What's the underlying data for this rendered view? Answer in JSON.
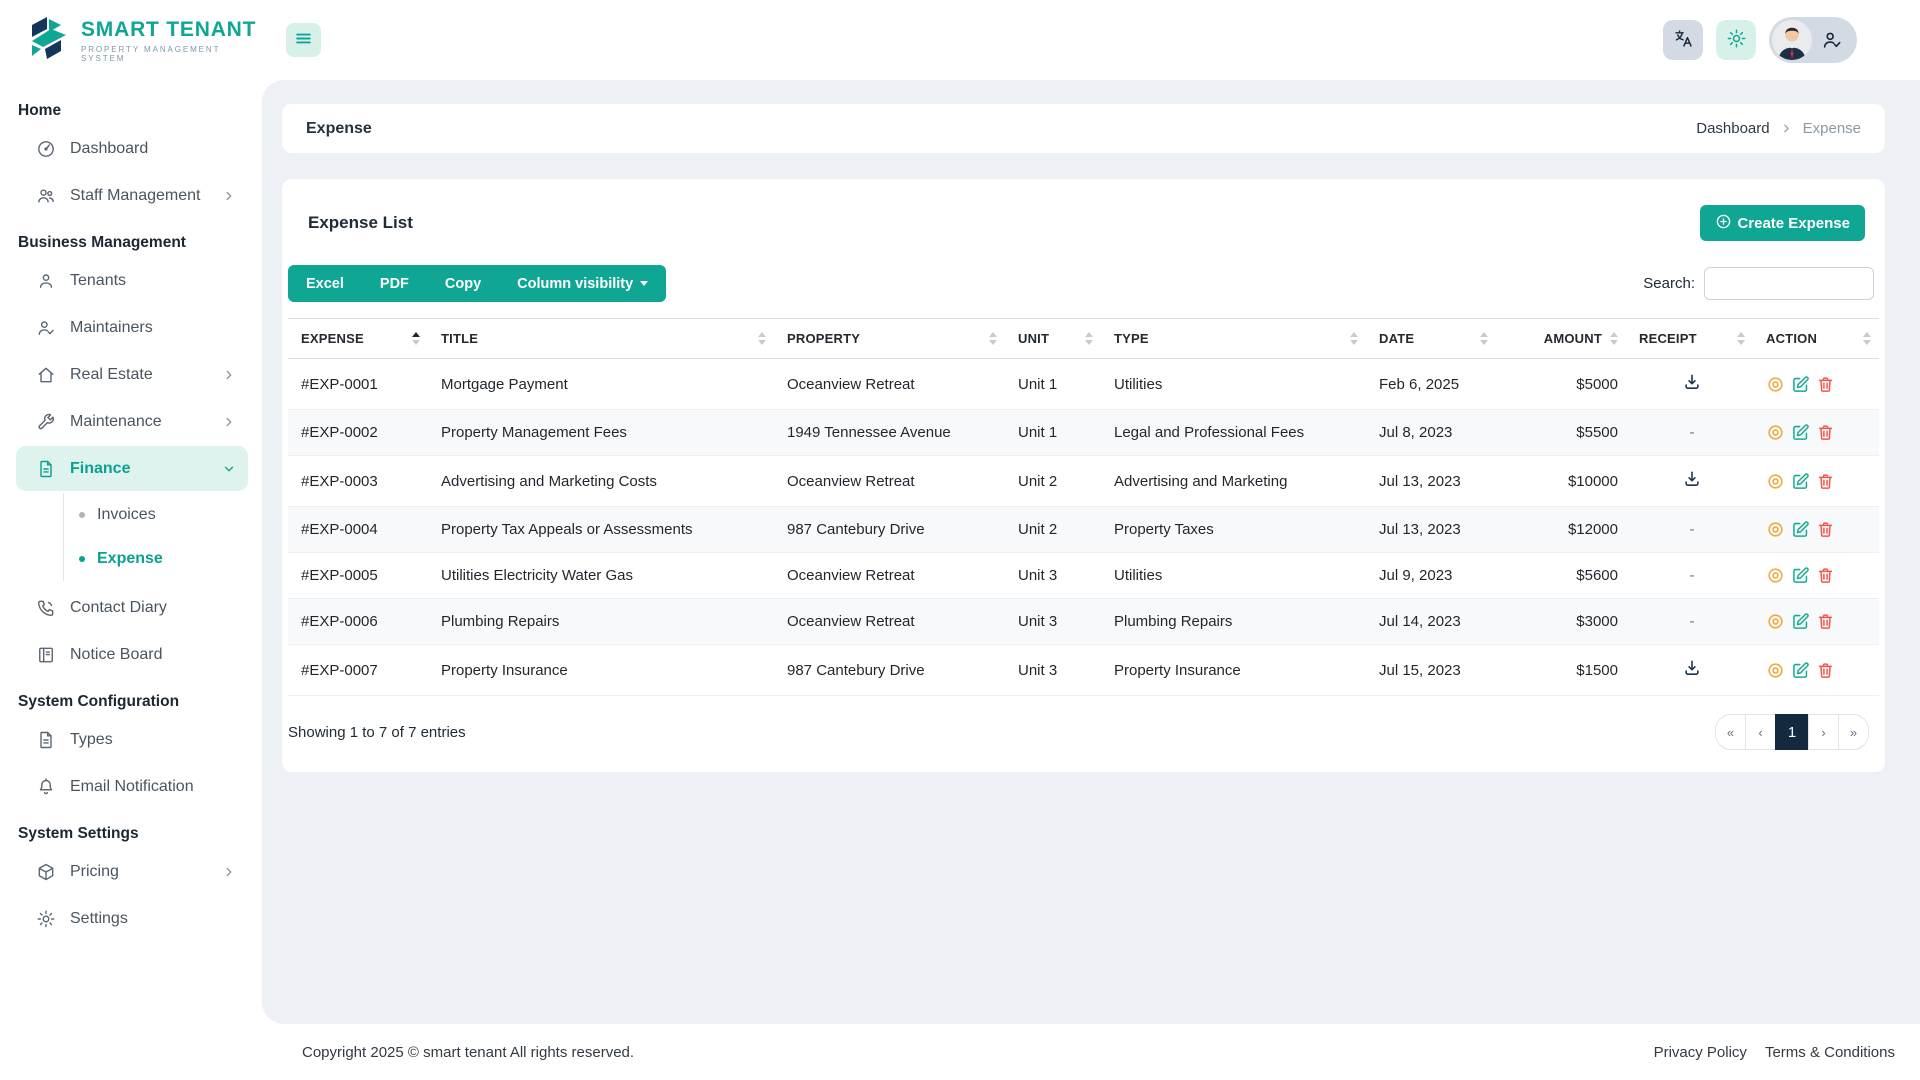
{
  "brand": {
    "name": "SMART TENANT",
    "tagline": "PROPERTY MANAGEMENT SYSTEM"
  },
  "topbar": {
    "icons": [
      "menu-icon",
      "translate-icon",
      "gear-icon",
      "user-avatar",
      "person-check-icon"
    ]
  },
  "sidebar": {
    "sections": [
      {
        "label": "Home",
        "items": [
          {
            "label": "Dashboard",
            "icon": "dashboard-icon"
          },
          {
            "label": "Staff Management",
            "icon": "staff-icon",
            "expandable": true
          }
        ]
      },
      {
        "label": "Business Management",
        "items": [
          {
            "label": "Tenants",
            "icon": "tenant-icon"
          },
          {
            "label": "Maintainers",
            "icon": "maintainer-icon"
          },
          {
            "label": "Real Estate",
            "icon": "home-icon",
            "expandable": true
          },
          {
            "label": "Maintenance",
            "icon": "wrench-icon",
            "expandable": true
          },
          {
            "label": "Finance",
            "icon": "finance-icon",
            "active": true,
            "expanded": true,
            "children": [
              {
                "label": "Invoices"
              },
              {
                "label": "Expense",
                "active": true
              }
            ]
          },
          {
            "label": "Contact Diary",
            "icon": "contact-icon"
          },
          {
            "label": "Notice Board",
            "icon": "board-icon"
          }
        ]
      },
      {
        "label": "System Configuration",
        "items": [
          {
            "label": "Types",
            "icon": "types-icon"
          },
          {
            "label": "Email Notification",
            "icon": "bell-icon"
          }
        ]
      },
      {
        "label": "System Settings",
        "items": [
          {
            "label": "Pricing",
            "icon": "pricing-icon",
            "expandable": true
          },
          {
            "label": "Settings",
            "icon": "settings-icon"
          }
        ]
      }
    ]
  },
  "page": {
    "breadcrumb_title": "Expense",
    "breadcrumb": [
      "Dashboard",
      "Expense"
    ]
  },
  "expense_card": {
    "title": "Expense List",
    "create_button": "Create Expense",
    "export_buttons": [
      "Excel",
      "PDF",
      "Copy"
    ],
    "column_visibility_label": "Column visibility",
    "search_label": "Search:",
    "table": {
      "columns": [
        "EXPENSE",
        "TITLE",
        "PROPERTY",
        "UNIT",
        "TYPE",
        "DATE",
        "AMOUNT",
        "RECEIPT",
        "ACTION"
      ],
      "sorted_column_index": 0,
      "sort_direction": "asc",
      "action_icons": [
        "view-icon",
        "edit-icon",
        "delete-icon"
      ],
      "receipt_icon": "download-icon",
      "rows": [
        {
          "expense": "#EXP-0001",
          "title": "Mortgage Payment",
          "property": "Oceanview Retreat",
          "unit": "Unit 1",
          "type": "Utilities",
          "date": "Feb 6, 2025",
          "amount": "$5000",
          "receipt": "download"
        },
        {
          "expense": "#EXP-0002",
          "title": "Property Management Fees",
          "property": "1949 Tennessee Avenue",
          "unit": "Unit 1",
          "type": "Legal and Professional Fees",
          "date": "Jul 8, 2023",
          "amount": "$5500",
          "receipt": "-"
        },
        {
          "expense": "#EXP-0003",
          "title": "Advertising and Marketing Costs",
          "property": "Oceanview Retreat",
          "unit": "Unit 2",
          "type": "Advertising and Marketing",
          "date": "Jul 13, 2023",
          "amount": "$10000",
          "receipt": "download"
        },
        {
          "expense": "#EXP-0004",
          "title": "Property Tax Appeals or Assessments",
          "property": "987 Cantebury Drive",
          "unit": "Unit 2",
          "type": "Property Taxes",
          "date": "Jul 13, 2023",
          "amount": "$12000",
          "receipt": "-"
        },
        {
          "expense": "#EXP-0005",
          "title": "Utilities Electricity Water Gas",
          "property": "Oceanview Retreat",
          "unit": "Unit 3",
          "type": "Utilities",
          "date": "Jul 9, 2023",
          "amount": "$5600",
          "receipt": "-"
        },
        {
          "expense": "#EXP-0006",
          "title": "Plumbing Repairs",
          "property": "Oceanview Retreat",
          "unit": "Unit 3",
          "type": "Plumbing Repairs",
          "date": "Jul 14, 2023",
          "amount": "$3000",
          "receipt": "-"
        },
        {
          "expense": "#EXP-0007",
          "title": "Property Insurance",
          "property": "987 Cantebury Drive",
          "unit": "Unit 3",
          "type": "Property Insurance",
          "date": "Jul 15, 2023",
          "amount": "$1500",
          "receipt": "download"
        }
      ]
    },
    "summary": "Showing 1 to 7 of 7 entries",
    "pagination": {
      "controls": [
        "«",
        "‹",
        "1",
        "›",
        "»"
      ],
      "active_index": 2
    }
  },
  "footer": {
    "copyright": "Copyright 2025 © smart tenant All rights reserved.",
    "links": [
      "Privacy Policy",
      "Terms & Conditions"
    ]
  },
  "colors": {
    "brand_teal": "#0fa694",
    "brand_teal_light": "#def2ee",
    "navy": "#13293d",
    "panel_background": "#edf1f5",
    "view_icon": "#f0a93c",
    "edit_icon": "#13ac92",
    "delete_icon": "#f25749"
  }
}
